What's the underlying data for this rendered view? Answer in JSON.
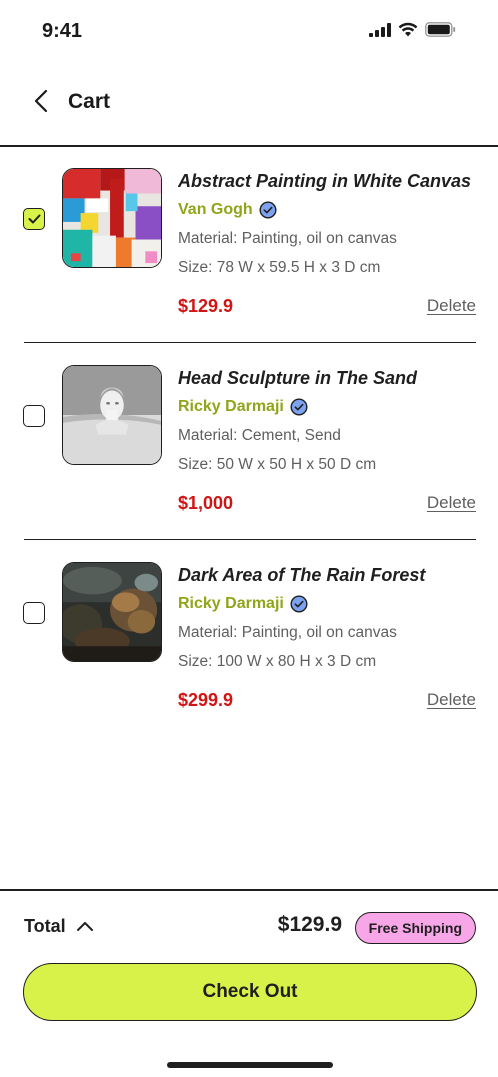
{
  "status_bar": {
    "time": "9:41"
  },
  "header": {
    "title": "Cart"
  },
  "items": [
    {
      "title": "Abstract Painting in White Canvas",
      "artist": "Van Gogh",
      "material": "Material: Painting, oil on canvas",
      "size": "Size: 78 W x 59.5 H x 3 D cm",
      "price": "$129.9",
      "delete_label": "Delete",
      "checked": true,
      "image_icon": "abstract-painting-image"
    },
    {
      "title": "Head Sculpture in The Sand",
      "artist": "Ricky Darmaji",
      "material": "Material: Cement, Send",
      "size": "Size: 50 W x 50 H x 50 D cm",
      "price": "$1,000",
      "delete_label": "Delete",
      "checked": false,
      "image_icon": "sculpture-image"
    },
    {
      "title": "Dark Area of The Rain Forest",
      "artist": "Ricky Darmaji",
      "material": "Material: Painting, oil on canvas",
      "size": "Size: 100 W x 80 H x 3 D cm",
      "price": "$299.9",
      "delete_label": "Delete",
      "checked": false,
      "image_icon": "forest-painting-image"
    }
  ],
  "summary": {
    "total_label": "Total",
    "total_amount": "$129.9",
    "shipping_badge": "Free Shipping"
  },
  "checkout": {
    "label": "Check Out"
  },
  "colors": {
    "accent": "#d9f24a",
    "artist": "#8fa61a",
    "price": "#d11414",
    "badge": "#f7a6e8",
    "verified": "#7da3f0"
  }
}
